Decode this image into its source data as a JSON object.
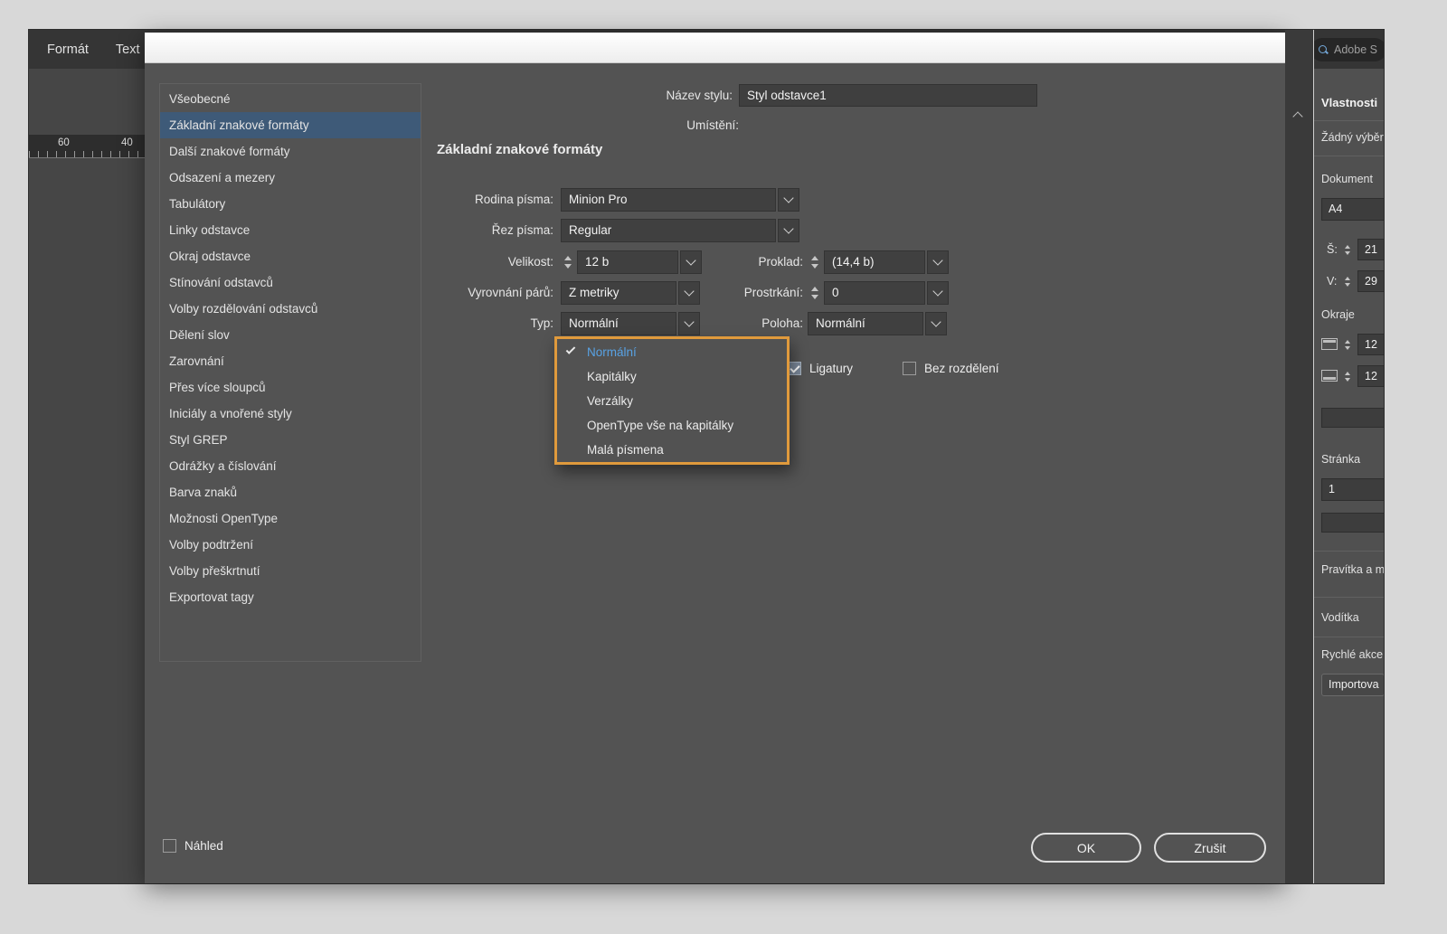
{
  "menubar": {
    "items": [
      "Formát",
      "Text"
    ]
  },
  "ruler": {
    "marks": [
      "60",
      "40"
    ]
  },
  "search": {
    "text": "Adobe S"
  },
  "dialog": {
    "name_row": {
      "label": "Název stylu:",
      "value": "Styl odstavce1"
    },
    "location_label": "Umístění:",
    "section_title": "Základní znakové formáty",
    "sidebar": [
      "Všeobecné",
      "Základní znakové formáty",
      "Další znakové formáty",
      "Odsazení a mezery",
      "Tabulátory",
      "Linky odstavce",
      "Okraj odstavce",
      "Stínování odstavců",
      "Volby rozdělování odstavců",
      "Dělení slov",
      "Zarovnání",
      "Přes více sloupců",
      "Iniciály a vnořené styly",
      "Styl GREP",
      "Odrážky a číslování",
      "Barva znaků",
      "Možnosti OpenType",
      "Volby podtržení",
      "Volby přeškrtnutí",
      "Exportovat tagy"
    ],
    "fields": {
      "family": {
        "label": "Rodina písma:",
        "value": "Minion Pro"
      },
      "style": {
        "label": "Řez písma:",
        "value": "Regular"
      },
      "size": {
        "label": "Velikost:",
        "value": "12 b"
      },
      "leading": {
        "label": "Proklad:",
        "value": "(14,4 b)"
      },
      "kerning": {
        "label": "Vyrovnání párů:",
        "value": "Z metriky"
      },
      "tracking": {
        "label": "Prostrkání:",
        "value": "0"
      },
      "case": {
        "label": "Typ:",
        "value": "Normální"
      },
      "position": {
        "label": "Poloha:",
        "value": "Normální"
      }
    },
    "case_menu": [
      {
        "label": "Normální",
        "checked": true
      },
      {
        "label": "Kapitálky",
        "checked": false
      },
      {
        "label": "Verzálky",
        "checked": false
      },
      {
        "label": "OpenType vše na kapitálky",
        "checked": false
      },
      {
        "label": "Malá písmena",
        "checked": false
      }
    ],
    "options": {
      "ligatures": "Ligatury",
      "no_break": "Bez rozdělení"
    },
    "preview_label": "Náhled",
    "ok": "OK",
    "cancel": "Zrušit"
  },
  "panel": {
    "title": "Vlastnosti",
    "selection": "Žádný výběr",
    "document_label": "Dokument",
    "preset": "A4",
    "width_label": "Š:",
    "width_value": "21",
    "height_label": "V:",
    "height_value": "29",
    "margins_label": "Okraje",
    "margin_top": "12",
    "margin_bottom": "12",
    "page_label": "Stránka",
    "page_value": "1",
    "rulers_label": "Pravítka a m",
    "guides_label": "Vodítka",
    "quick_actions_label": "Rychlé akce",
    "import_label": "Importova"
  },
  "colors": {
    "highlight_border": "#E09A3C",
    "selection_blue": "#3e5a78",
    "menu_checked_text": "#58a2e4"
  }
}
